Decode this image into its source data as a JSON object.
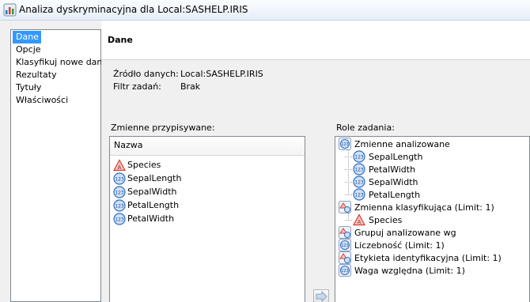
{
  "window": {
    "title": "Analiza dyskryminacyjna dla Local:SASHELP.IRIS"
  },
  "nav": {
    "items": [
      "Dane",
      "Opcje",
      "Klasyfikuj nowe dane",
      "Rezultaty",
      "Tytuły",
      "Właściwości"
    ],
    "selected": "Dane"
  },
  "page": {
    "title": "Dane"
  },
  "info": {
    "source_label": "Źródło danych:",
    "source_value": "Local:SASHELP.IRIS",
    "filter_label": "Filtr zadań:",
    "filter_value": "Brak"
  },
  "variables": {
    "label": "Zmienne przypisywane:",
    "column_header": "Nazwa",
    "items": [
      {
        "name": "Species",
        "icon": "character-variable-icon"
      },
      {
        "name": "SepalLength",
        "icon": "numeric-variable-icon"
      },
      {
        "name": "SepalWidth",
        "icon": "numeric-variable-icon"
      },
      {
        "name": "PetalLength",
        "icon": "numeric-variable-icon"
      },
      {
        "name": "PetalWidth",
        "icon": "numeric-variable-icon"
      }
    ]
  },
  "roles": {
    "label": "Role zadania:",
    "groups": [
      {
        "label": "Zmienne analizowane",
        "children": [
          "SepalLength",
          "PetalWidth",
          "SepalWidth",
          "PetalLength"
        ]
      },
      {
        "label": "Zmienna klasyfikująca  (Limit: 1)",
        "children": [
          "Species"
        ]
      },
      {
        "label": "Grupuj analizowane wg",
        "children": []
      },
      {
        "label": "Liczebność  (Limit: 1)",
        "children": []
      },
      {
        "label": "Etykieta identyfikacyjna  (Limit: 1)",
        "children": []
      },
      {
        "label": "Waga względna  (Limit: 1)",
        "children": []
      }
    ]
  },
  "colors": {
    "selection": "#3399ff",
    "numeric_icon": "#2f6fc4",
    "character_icon": "#d83a2f"
  }
}
